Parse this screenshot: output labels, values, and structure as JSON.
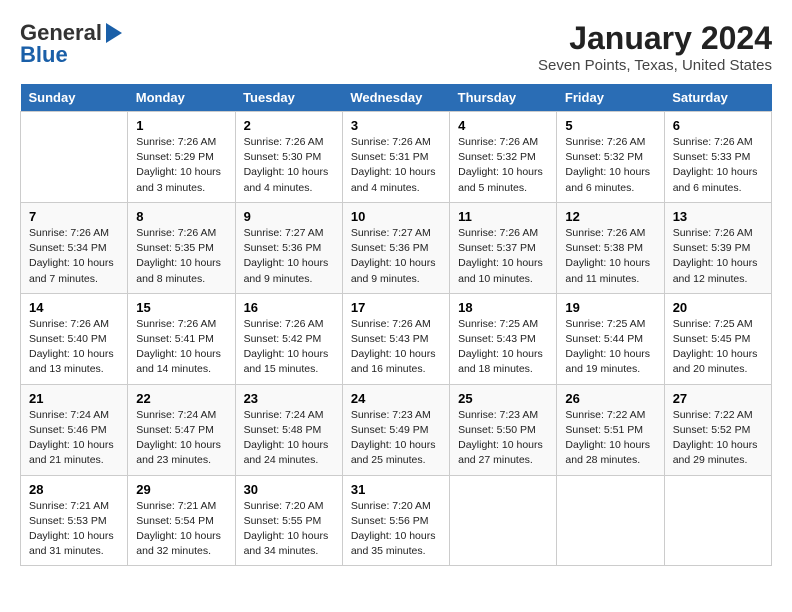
{
  "header": {
    "logo_line1": "General",
    "logo_line2": "Blue",
    "title": "January 2024",
    "subtitle": "Seven Points, Texas, United States"
  },
  "days_of_week": [
    "Sunday",
    "Monday",
    "Tuesday",
    "Wednesday",
    "Thursday",
    "Friday",
    "Saturday"
  ],
  "weeks": [
    [
      {
        "day": "",
        "content": ""
      },
      {
        "day": "1",
        "content": "Sunrise: 7:26 AM\nSunset: 5:29 PM\nDaylight: 10 hours\nand 3 minutes."
      },
      {
        "day": "2",
        "content": "Sunrise: 7:26 AM\nSunset: 5:30 PM\nDaylight: 10 hours\nand 4 minutes."
      },
      {
        "day": "3",
        "content": "Sunrise: 7:26 AM\nSunset: 5:31 PM\nDaylight: 10 hours\nand 4 minutes."
      },
      {
        "day": "4",
        "content": "Sunrise: 7:26 AM\nSunset: 5:32 PM\nDaylight: 10 hours\nand 5 minutes."
      },
      {
        "day": "5",
        "content": "Sunrise: 7:26 AM\nSunset: 5:32 PM\nDaylight: 10 hours\nand 6 minutes."
      },
      {
        "day": "6",
        "content": "Sunrise: 7:26 AM\nSunset: 5:33 PM\nDaylight: 10 hours\nand 6 minutes."
      }
    ],
    [
      {
        "day": "7",
        "content": "Sunrise: 7:26 AM\nSunset: 5:34 PM\nDaylight: 10 hours\nand 7 minutes."
      },
      {
        "day": "8",
        "content": "Sunrise: 7:26 AM\nSunset: 5:35 PM\nDaylight: 10 hours\nand 8 minutes."
      },
      {
        "day": "9",
        "content": "Sunrise: 7:27 AM\nSunset: 5:36 PM\nDaylight: 10 hours\nand 9 minutes."
      },
      {
        "day": "10",
        "content": "Sunrise: 7:27 AM\nSunset: 5:36 PM\nDaylight: 10 hours\nand 9 minutes."
      },
      {
        "day": "11",
        "content": "Sunrise: 7:26 AM\nSunset: 5:37 PM\nDaylight: 10 hours\nand 10 minutes."
      },
      {
        "day": "12",
        "content": "Sunrise: 7:26 AM\nSunset: 5:38 PM\nDaylight: 10 hours\nand 11 minutes."
      },
      {
        "day": "13",
        "content": "Sunrise: 7:26 AM\nSunset: 5:39 PM\nDaylight: 10 hours\nand 12 minutes."
      }
    ],
    [
      {
        "day": "14",
        "content": "Sunrise: 7:26 AM\nSunset: 5:40 PM\nDaylight: 10 hours\nand 13 minutes."
      },
      {
        "day": "15",
        "content": "Sunrise: 7:26 AM\nSunset: 5:41 PM\nDaylight: 10 hours\nand 14 minutes."
      },
      {
        "day": "16",
        "content": "Sunrise: 7:26 AM\nSunset: 5:42 PM\nDaylight: 10 hours\nand 15 minutes."
      },
      {
        "day": "17",
        "content": "Sunrise: 7:26 AM\nSunset: 5:43 PM\nDaylight: 10 hours\nand 16 minutes."
      },
      {
        "day": "18",
        "content": "Sunrise: 7:25 AM\nSunset: 5:43 PM\nDaylight: 10 hours\nand 18 minutes."
      },
      {
        "day": "19",
        "content": "Sunrise: 7:25 AM\nSunset: 5:44 PM\nDaylight: 10 hours\nand 19 minutes."
      },
      {
        "day": "20",
        "content": "Sunrise: 7:25 AM\nSunset: 5:45 PM\nDaylight: 10 hours\nand 20 minutes."
      }
    ],
    [
      {
        "day": "21",
        "content": "Sunrise: 7:24 AM\nSunset: 5:46 PM\nDaylight: 10 hours\nand 21 minutes."
      },
      {
        "day": "22",
        "content": "Sunrise: 7:24 AM\nSunset: 5:47 PM\nDaylight: 10 hours\nand 23 minutes."
      },
      {
        "day": "23",
        "content": "Sunrise: 7:24 AM\nSunset: 5:48 PM\nDaylight: 10 hours\nand 24 minutes."
      },
      {
        "day": "24",
        "content": "Sunrise: 7:23 AM\nSunset: 5:49 PM\nDaylight: 10 hours\nand 25 minutes."
      },
      {
        "day": "25",
        "content": "Sunrise: 7:23 AM\nSunset: 5:50 PM\nDaylight: 10 hours\nand 27 minutes."
      },
      {
        "day": "26",
        "content": "Sunrise: 7:22 AM\nSunset: 5:51 PM\nDaylight: 10 hours\nand 28 minutes."
      },
      {
        "day": "27",
        "content": "Sunrise: 7:22 AM\nSunset: 5:52 PM\nDaylight: 10 hours\nand 29 minutes."
      }
    ],
    [
      {
        "day": "28",
        "content": "Sunrise: 7:21 AM\nSunset: 5:53 PM\nDaylight: 10 hours\nand 31 minutes."
      },
      {
        "day": "29",
        "content": "Sunrise: 7:21 AM\nSunset: 5:54 PM\nDaylight: 10 hours\nand 32 minutes."
      },
      {
        "day": "30",
        "content": "Sunrise: 7:20 AM\nSunset: 5:55 PM\nDaylight: 10 hours\nand 34 minutes."
      },
      {
        "day": "31",
        "content": "Sunrise: 7:20 AM\nSunset: 5:56 PM\nDaylight: 10 hours\nand 35 minutes."
      },
      {
        "day": "",
        "content": ""
      },
      {
        "day": "",
        "content": ""
      },
      {
        "day": "",
        "content": ""
      }
    ]
  ]
}
